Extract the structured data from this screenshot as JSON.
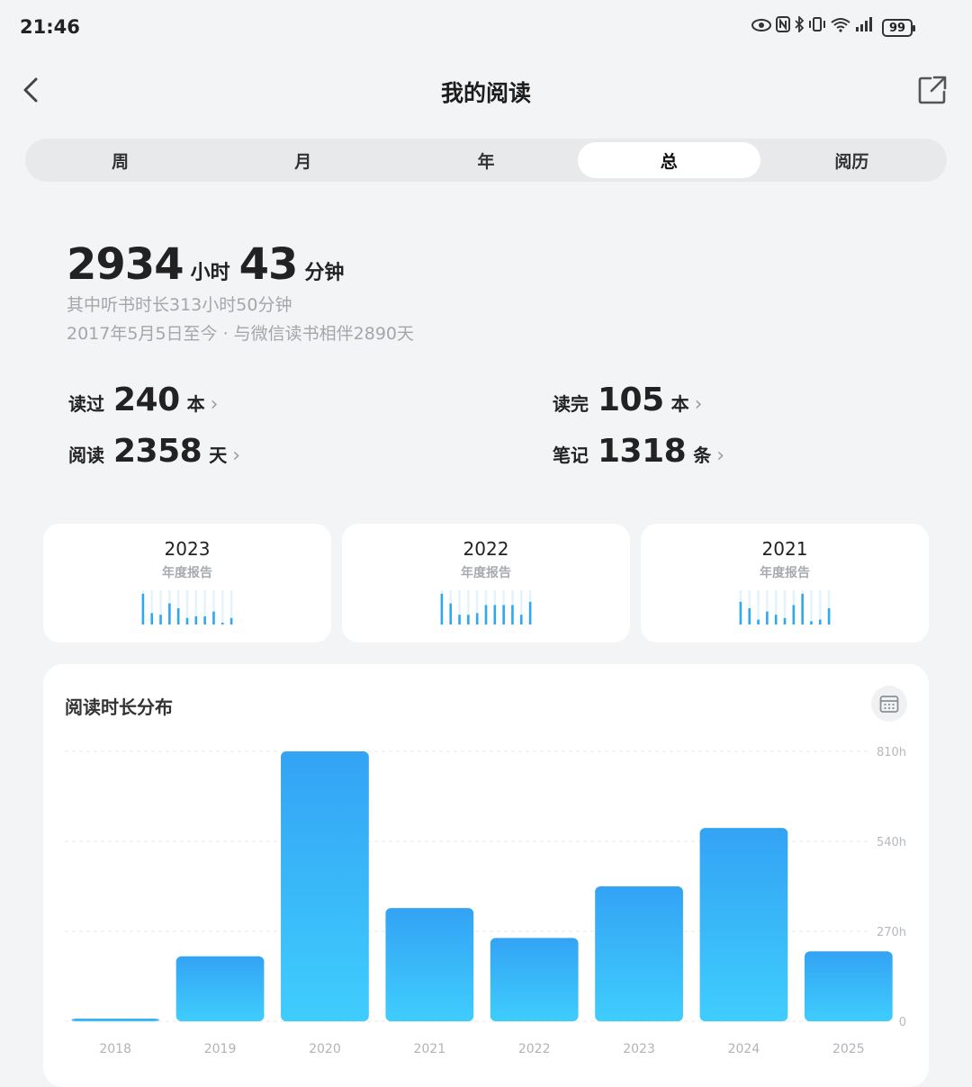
{
  "status": {
    "time": "21:46",
    "battery": "99"
  },
  "nav": {
    "title": "我的阅读"
  },
  "tabs": [
    {
      "label": "周"
    },
    {
      "label": "月"
    },
    {
      "label": "年"
    },
    {
      "label": "总",
      "active": true
    },
    {
      "label": "阅历"
    }
  ],
  "summary": {
    "hours": "2934",
    "hours_unit": "小时",
    "minutes": "43",
    "minutes_unit": "分钟",
    "listen_line": "其中听书时长313小时50分钟",
    "since_line": "2017年5月5日至今 · 与微信读书相伴2890天"
  },
  "stats": {
    "read": {
      "label": "读过",
      "value": "240",
      "unit": "本"
    },
    "finished": {
      "label": "读完",
      "value": "105",
      "unit": "本"
    },
    "days": {
      "label": "阅读",
      "value": "2358",
      "unit": "天"
    },
    "notes": {
      "label": "笔记",
      "value": "1318",
      "unit": "条"
    }
  },
  "reports": [
    {
      "year": "2023",
      "subtitle": "年度报告",
      "spark": [
        0.95,
        0.35,
        0.3,
        0.65,
        0.5,
        0.2,
        0.25,
        0.25,
        0.4,
        0.05,
        0.2
      ]
    },
    {
      "year": "2022",
      "subtitle": "年度报告",
      "spark": [
        0.95,
        0.65,
        0.3,
        0.3,
        0.35,
        0.6,
        0.6,
        0.6,
        0.6,
        0.3,
        0.7
      ]
    },
    {
      "year": "2021",
      "subtitle": "年度报告",
      "spark": [
        0.7,
        0.5,
        0.15,
        0.4,
        0.3,
        0.2,
        0.6,
        0.95,
        0.1,
        0.15,
        0.5
      ]
    }
  ],
  "chart_title": "阅读时长分布",
  "colors": {
    "bar_top": "#33a3f4",
    "bar_bottom": "#3fcdfd",
    "accent": "#2ea8f0"
  },
  "chart_data": {
    "type": "bar",
    "categories": [
      "2018",
      "2019",
      "2020",
      "2021",
      "2022",
      "2023",
      "2024",
      "2025"
    ],
    "values": [
      8,
      195,
      810,
      340,
      250,
      405,
      580,
      210
    ],
    "ylim": [
      0,
      810
    ],
    "yticks": [
      0,
      270,
      540,
      810
    ],
    "ytick_labels": [
      "0",
      "270h",
      "540h",
      "810h"
    ],
    "grid": true
  }
}
